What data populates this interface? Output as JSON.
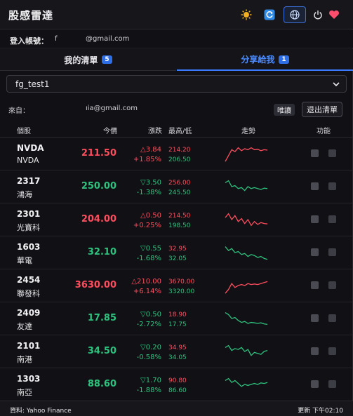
{
  "header": {
    "title": "股感雷達"
  },
  "account": {
    "label": "登入帳號：",
    "name": "f",
    "email": "@gmail.com"
  },
  "tabs": [
    {
      "label": "我的清單",
      "count": "5"
    },
    {
      "label": "分享給我",
      "count": "1"
    }
  ],
  "list_select": {
    "value": "fg_test1"
  },
  "from": {
    "label": "來自：",
    "email": "ıia@gmail.com",
    "readonly_label": "唯讀",
    "exit_label": "退出清單"
  },
  "columns": {
    "stock": "個股",
    "price": "今價",
    "change": "漲跌",
    "high_low": "最高/低",
    "trend": "走勢",
    "function": "功能"
  },
  "colors": {
    "up": "#ff4d5e",
    "down": "#2ec27e",
    "accent": "#3b7bff"
  },
  "stocks": [
    {
      "code": "NVDA",
      "name": "NVDA",
      "price": "211.50",
      "change": "△3.84",
      "pct": "+1.85%",
      "high": "214.20",
      "low": "206.50",
      "dir": "up"
    },
    {
      "code": "2317",
      "name": "鴻海",
      "price": "250.00",
      "change": "▽3.50",
      "pct": "-1.38%",
      "high": "256.00",
      "low": "245.50",
      "dir": "down"
    },
    {
      "code": "2301",
      "name": "光寶科",
      "price": "204.00",
      "change": "△0.50",
      "pct": "+0.25%",
      "high": "214.50",
      "low": "198.50",
      "dir": "up"
    },
    {
      "code": "1603",
      "name": "華電",
      "price": "32.10",
      "change": "▽0.55",
      "pct": "-1.68%",
      "high": "32.95",
      "low": "32.05",
      "dir": "down"
    },
    {
      "code": "2454",
      "name": "聯發科",
      "price": "3630.00",
      "change": "△210.00",
      "pct": "+6.14%",
      "high": "3670.00",
      "low": "3320.00",
      "dir": "up"
    },
    {
      "code": "2409",
      "name": "友達",
      "price": "17.85",
      "change": "▽0.50",
      "pct": "-2.72%",
      "high": "18.90",
      "low": "17.75",
      "dir": "down"
    },
    {
      "code": "2101",
      "name": "南港",
      "price": "34.50",
      "change": "▽0.20",
      "pct": "-0.58%",
      "high": "34.95",
      "low": "34.05",
      "dir": "down"
    },
    {
      "code": "1303",
      "name": "南亞",
      "price": "88.60",
      "change": "▽1.70",
      "pct": "-1.88%",
      "high": "90.80",
      "low": "86.60",
      "dir": "down"
    }
  ],
  "footer": {
    "source": "資料: Yahoo Finance",
    "updated": "更新 下午02:10"
  }
}
